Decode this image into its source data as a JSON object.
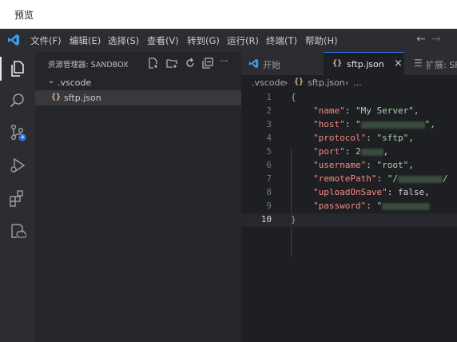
{
  "window": {
    "title": "预览"
  },
  "menu": {
    "items": [
      "文件(F)",
      "编辑(E)",
      "选择(S)",
      "查看(V)",
      "转到(G)",
      "运行(R)",
      "终端(T)",
      "帮助(H)"
    ]
  },
  "sidebar": {
    "title": "资源管理器: SANDBOX",
    "more": "···",
    "tree": [
      {
        "label": ".vscode",
        "kind": "folder",
        "expanded": true
      },
      {
        "label": "sftp.json",
        "kind": "json",
        "selected": true
      }
    ]
  },
  "tabs": [
    {
      "label": "开始",
      "active": false
    },
    {
      "label": "sftp.json",
      "active": true,
      "close": "×"
    },
    {
      "label": "扩展: SF",
      "active": false
    }
  ],
  "breadcrumb": {
    "folder": ".vscode",
    "file": "sftp.json",
    "tail": "..."
  },
  "editor": {
    "lines": [
      {
        "n": "1",
        "open": "{"
      },
      {
        "n": "2",
        "key": "\"name\"",
        "value": "\"My Server\"",
        "tail": ","
      },
      {
        "n": "3",
        "key": "\"host\"",
        "value": "\"",
        "redacted": true,
        "tail": "\","
      },
      {
        "n": "4",
        "key": "\"protocol\"",
        "value": "\"sftp\"",
        "tail": ","
      },
      {
        "n": "5",
        "key": "\"port\"",
        "value": "2",
        "redacted": true,
        "tail": ","
      },
      {
        "n": "6",
        "key": "\"username\"",
        "value": "\"root\"",
        "tail": ","
      },
      {
        "n": "7",
        "key": "\"remotePath\"",
        "value": "\"/",
        "redacted": true,
        "tail": "/"
      },
      {
        "n": "8",
        "key": "\"uploadOnSave\"",
        "value": "false",
        "tail": ","
      },
      {
        "n": "9",
        "key": "\"password\"",
        "value": "\"",
        "redacted": true,
        "tail": ""
      },
      {
        "n": "10",
        "close": "}"
      }
    ],
    "current_line": "10"
  },
  "colors": {
    "accent": "#3574f0",
    "json_key": "#f28b82",
    "json_string": "#a5d6a7",
    "brace": "#ef8f54"
  },
  "icons": [
    "vscode-logo",
    "explorer-icon",
    "search-icon",
    "source-control-icon",
    "run-debug-icon",
    "extensions-icon",
    "remote-explorer-icon",
    "new-file-icon",
    "new-folder-icon",
    "refresh-icon",
    "collapse-all-icon",
    "arrow-left-icon",
    "arrow-right-icon",
    "json-file-icon"
  ]
}
